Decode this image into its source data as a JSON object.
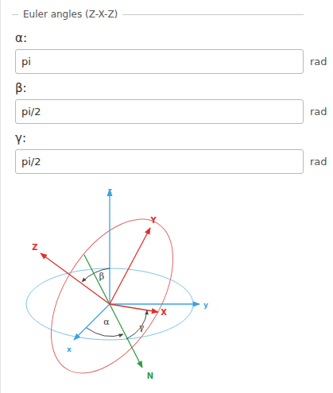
{
  "panel": {
    "legend": "Euler angles (Z-X-Z)"
  },
  "fields": [
    {
      "label": "α:",
      "value": "pi",
      "unit": "rad"
    },
    {
      "label": "β:",
      "value": "pi/2",
      "unit": "rad"
    },
    {
      "label": "γ:",
      "value": "pi/2",
      "unit": "rad"
    }
  ],
  "diagram": {
    "fixed_axes": [
      "z",
      "y",
      "x"
    ],
    "rotated_axes": [
      "Z",
      "Y",
      "X"
    ],
    "node_line": "N",
    "angles": [
      "α",
      "β",
      "γ"
    ]
  }
}
